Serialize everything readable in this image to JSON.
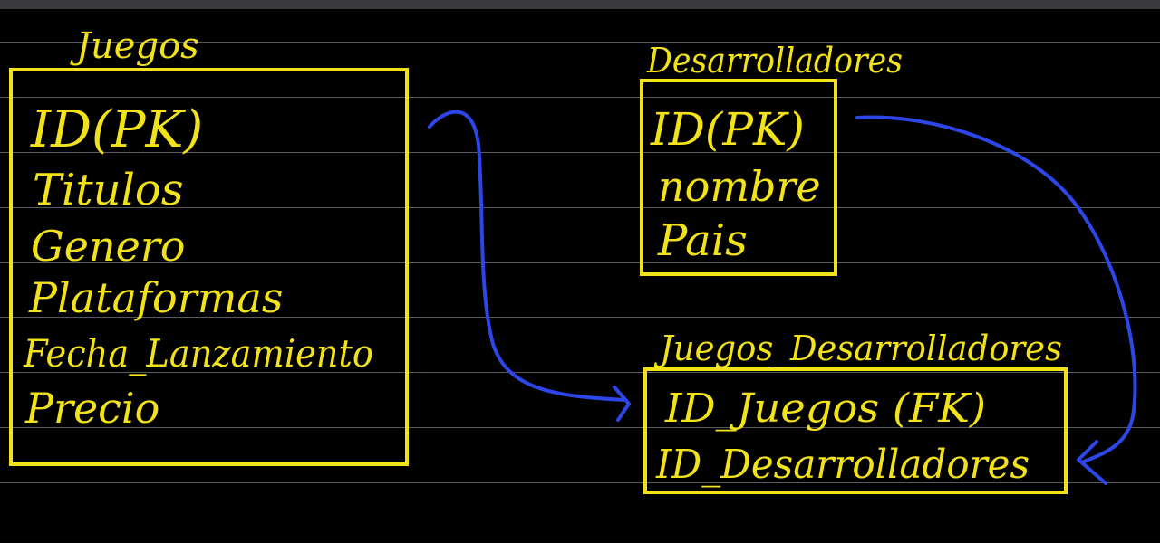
{
  "colors": {
    "ink": "#f2e21a",
    "arrow": "#2d46e8",
    "background": "#000000",
    "rule": "#5a5a5c"
  },
  "tables": {
    "juegos": {
      "title": "Juegos",
      "fields": [
        "ID(PK)",
        "Titulos",
        "Genero",
        "Plataformas",
        "Fecha_Lanzamiento",
        "Precio"
      ]
    },
    "desarrolladores": {
      "title": "Desarrolladores",
      "fields": [
        "ID(PK)",
        "nombre",
        "Pais"
      ]
    },
    "juegos_desarrolladores": {
      "title": "Juegos_Desarrolladores",
      "fields": [
        "ID_Juegos (FK)",
        "ID_Desarrolladores"
      ]
    }
  }
}
